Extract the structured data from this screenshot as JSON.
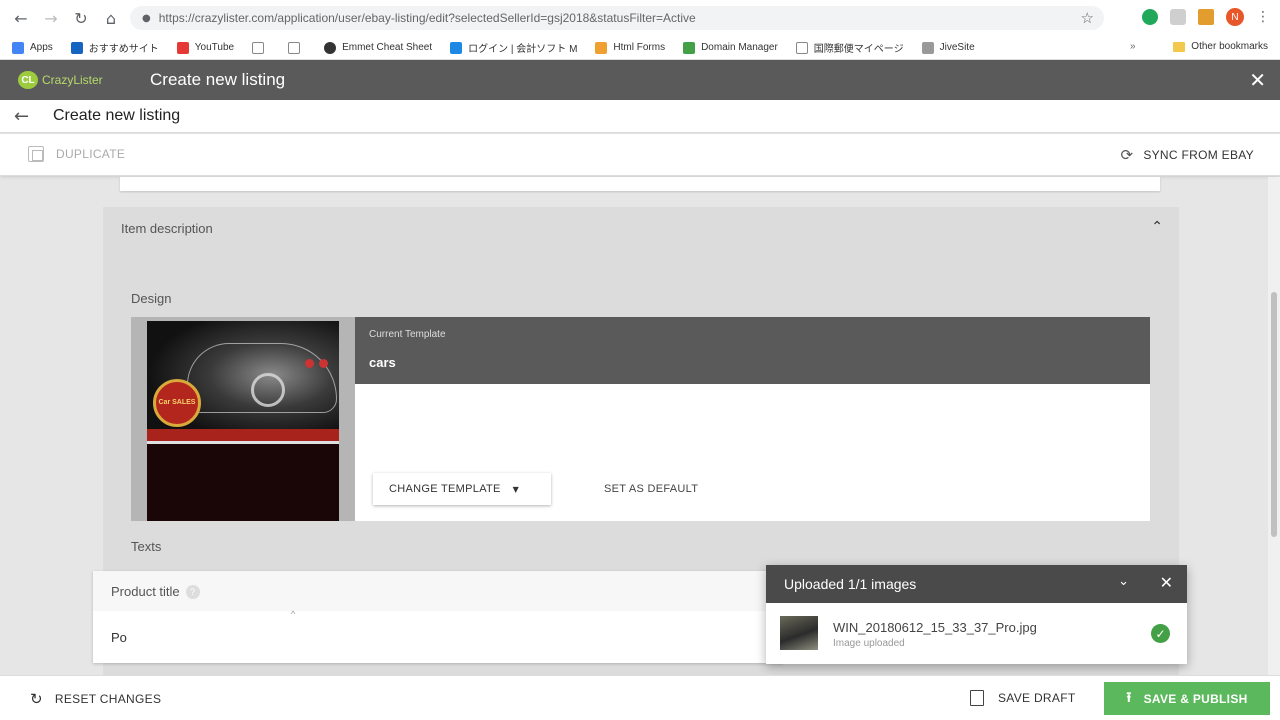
{
  "browser": {
    "back": "←",
    "forward": "→",
    "reload": "↻",
    "home": "⌂",
    "url": "https://crazylister.com/application/user/ebay-listing/edit?selectedSellerId=gsj2018&statusFilter=Active",
    "avatar_letter": "N",
    "bookmarks": [
      "Apps",
      "おすすめサイト",
      "YouTube",
      "",
      "",
      "Emmet Cheat Sheet",
      "ログイン | 会計ソフト M",
      "Html Forms",
      "Domain Manager",
      "国際郵便マイページ",
      "JiveSite"
    ],
    "bookmarks_more": "»",
    "other_bookmarks": "Other bookmarks"
  },
  "app": {
    "brand": "CrazyLister",
    "brand_mark": "CL",
    "title": "Create new listing",
    "close": "✕"
  },
  "subheader": {
    "back": "←",
    "title": "Create new listing"
  },
  "toolbar": {
    "duplicate": "DUPLICATE",
    "sync": "SYNC FROM EBAY",
    "sync_icon": "⟳"
  },
  "panel": {
    "heading": "Item description",
    "chevron": "⌃",
    "design_label": "Design",
    "current_template_label": "Current Template",
    "current_template_name": "cars",
    "change_template": "CHANGE TEMPLATE",
    "set_default": "SET AS DEFAULT",
    "texts_label": "Texts",
    "product_title_label": "Product title",
    "product_title_value": "Po",
    "thumb_badge": "Car SALES"
  },
  "toast": {
    "title": "Uploaded 1/1 images",
    "file_name": "WIN_20180612_15_33_37_Pro.jpg",
    "status": "Image uploaded"
  },
  "bottom": {
    "reset": "RESET CHANGES",
    "save_draft": "SAVE DRAFT",
    "publish": "SAVE & PUBLISH"
  },
  "colors": {
    "header": "#5a5a5a",
    "publish": "#5cb85c",
    "success": "#43a047",
    "brand": "#9ccc3d"
  },
  "icons": {
    "lock": "lock-icon",
    "star": "star-icon",
    "help": "help-icon",
    "check": "check-circle-icon"
  }
}
